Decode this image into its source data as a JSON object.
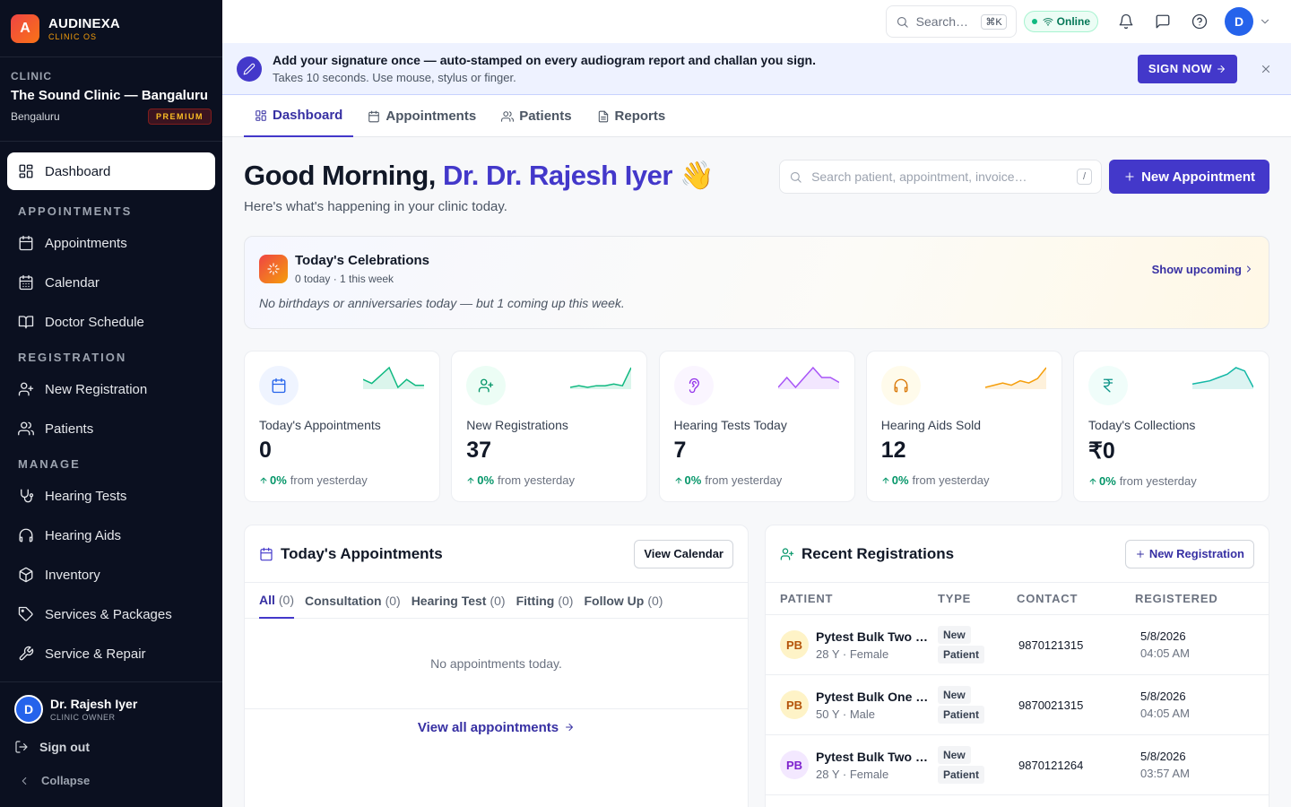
{
  "brand": {
    "logo_letter": "A",
    "name": "AUDINEXA",
    "sub": "CLINIC OS"
  },
  "clinic": {
    "label": "CLINIC",
    "name": "The Sound Clinic — Bangaluru",
    "city": "Bengaluru",
    "tier": "PREMIUM"
  },
  "sidebar": {
    "dashboard": "Dashboard",
    "sections": {
      "appointments": "APPOINTMENTS",
      "registration": "REGISTRATION",
      "manage": "MANAGE"
    },
    "items": {
      "appointments": "Appointments",
      "calendar": "Calendar",
      "doctor_schedule": "Doctor Schedule",
      "new_registration": "New Registration",
      "patients": "Patients",
      "hearing_tests": "Hearing Tests",
      "hearing_aids": "Hearing Aids",
      "inventory": "Inventory",
      "services_packages": "Services & Packages",
      "service_repair": "Service & Repair"
    },
    "user": {
      "initial": "D",
      "name": "Dr. Rajesh Iyer",
      "role": "CLINIC OWNER"
    },
    "sign_out": "Sign out",
    "collapse": "Collapse"
  },
  "topbar": {
    "search_label": "Search…",
    "shortcut": "⌘K",
    "status": "Online",
    "avatar_initial": "D"
  },
  "banner": {
    "title": "Add your signature once — auto-stamped on every audiogram report and challan you sign.",
    "subtitle": "Takes 10 seconds. Use mouse, stylus or finger.",
    "button": "SIGN NOW",
    "close": "×"
  },
  "tabs": [
    "Dashboard",
    "Appointments",
    "Patients",
    "Reports"
  ],
  "greeting": {
    "prefix": "Good Morning, ",
    "name": "Dr. Dr. Rajesh Iyer",
    "emoji": "👋",
    "subtitle": "Here's what's happening in your clinic today."
  },
  "main_search": {
    "placeholder": "Search patient, appointment, invoice…",
    "shortcut": "/"
  },
  "new_appointment": "New Appointment",
  "celebrations": {
    "title": "Today's Celebrations",
    "subtitle": "0 today · 1 this week",
    "link": "Show upcoming",
    "message": "No birthdays or anniversaries today — but 1 coming up this week."
  },
  "stats": [
    {
      "label": "Today's Appointments",
      "value": "0",
      "change": "0%",
      "suffix": "from yesterday",
      "icon": "calendar-icon",
      "color": "#2563eb",
      "bg": "#eff4ff",
      "spark_color": "#10b981",
      "spark": [
        6,
        4,
        8,
        12,
        2,
        6,
        3,
        3
      ]
    },
    {
      "label": "New Registrations",
      "value": "37",
      "change": "0%",
      "suffix": "from yesterday",
      "icon": "user-plus-icon",
      "color": "#059669",
      "bg": "#ecfdf5",
      "spark_color": "#10b981",
      "spark": [
        2,
        3,
        2,
        3,
        3,
        4,
        3,
        14
      ]
    },
    {
      "label": "Hearing Tests Today",
      "value": "7",
      "change": "0%",
      "suffix": "from yesterday",
      "icon": "ear-icon",
      "color": "#9333ea",
      "bg": "#faf5ff",
      "spark_color": "#a855f7",
      "spark": [
        7,
        9,
        7,
        9,
        11,
        9,
        9,
        8
      ]
    },
    {
      "label": "Hearing Aids Sold",
      "value": "12",
      "change": "0%",
      "suffix": "from yesterday",
      "icon": "headphones-icon",
      "color": "#d97706",
      "bg": "#fffbeb",
      "spark_color": "#f59e0b",
      "spark": [
        2,
        3,
        4,
        3,
        5,
        4,
        6,
        11
      ]
    },
    {
      "label": "Today's Collections",
      "value": "₹0",
      "change": "0%",
      "suffix": "from yesterday",
      "icon": "rupee-icon",
      "color": "#0d9488",
      "bg": "#f0fdfa",
      "spark_color": "#14b8a6",
      "spark": [
        4,
        5,
        6,
        8,
        10,
        14,
        12,
        2
      ]
    }
  ],
  "appointments_panel": {
    "title": "Today's Appointments",
    "button": "View Calendar",
    "filters": [
      {
        "label": "All",
        "count": "(0)"
      },
      {
        "label": "Consultation",
        "count": "(0)"
      },
      {
        "label": "Hearing Test",
        "count": "(0)"
      },
      {
        "label": "Fitting",
        "count": "(0)"
      },
      {
        "label": "Follow Up",
        "count": "(0)"
      }
    ],
    "empty": "No appointments today.",
    "view_all": "View all appointments"
  },
  "registrations_panel": {
    "title": "Recent Registrations",
    "button": "New Registration",
    "columns": [
      "PATIENT",
      "TYPE",
      "CONTACT",
      "REGISTERED"
    ],
    "rows": [
      {
        "initials": "PB",
        "name": "Pytest Bulk Two …",
        "meta": "28 Y · Female",
        "type1": "New",
        "type2": "Patient",
        "contact": "9870121315",
        "date": "5/8/2026",
        "time": "04:05 AM",
        "av_bg": "#fef3c7",
        "av_fg": "#b45309"
      },
      {
        "initials": "PB",
        "name": "Pytest Bulk One …",
        "meta": "50 Y · Male",
        "type1": "New",
        "type2": "Patient",
        "contact": "9870021315",
        "date": "5/8/2026",
        "time": "04:05 AM",
        "av_bg": "#fef3c7",
        "av_fg": "#b45309"
      },
      {
        "initials": "PB",
        "name": "Pytest Bulk Two …",
        "meta": "28 Y · Female",
        "type1": "New",
        "type2": "Patient",
        "contact": "9870121264",
        "date": "5/8/2026",
        "time": "03:57 AM",
        "av_bg": "#f3e8ff",
        "av_fg": "#7e22ce"
      }
    ]
  },
  "colors": {
    "accent": "#4338ca",
    "sidebar_bg": "#0b1020",
    "success": "#059669"
  }
}
